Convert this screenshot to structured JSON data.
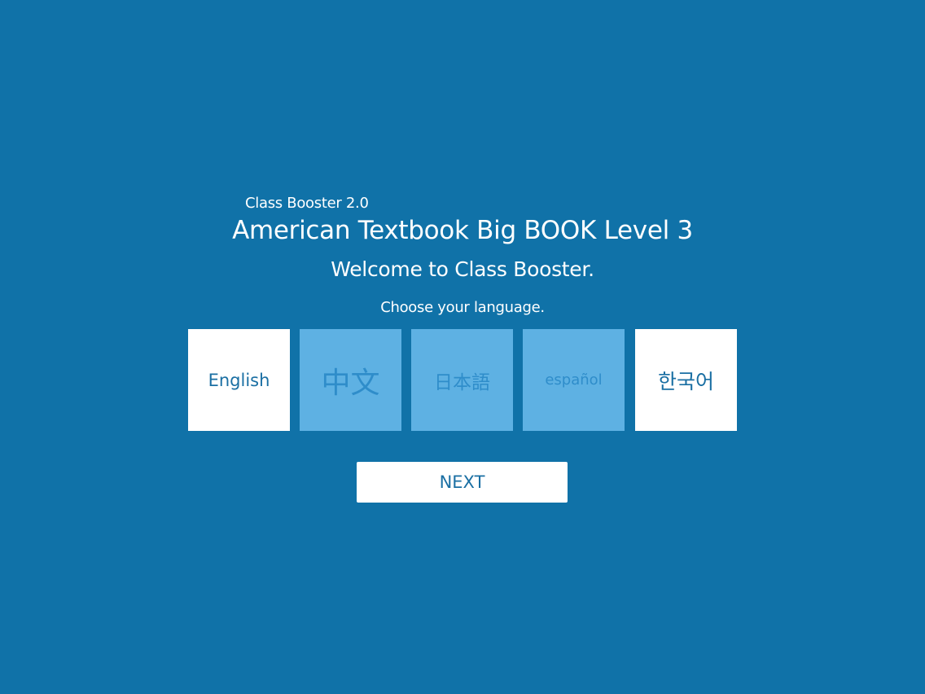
{
  "app": {
    "version_label": "Class Booster 2.0",
    "title": "American Textbook Big BOOK Level 3",
    "welcome": "Welcome to Class Booster.",
    "prompt": "Choose your language."
  },
  "languages": [
    {
      "label": "English",
      "selected": true
    },
    {
      "label": "中文",
      "selected": false
    },
    {
      "label": "日本語",
      "selected": false
    },
    {
      "label": "español",
      "selected": false
    },
    {
      "label": "한국어",
      "selected": true
    }
  ],
  "actions": {
    "next_label": "NEXT"
  },
  "colors": {
    "background": "#1072a8",
    "tile_selected": "#ffffff",
    "tile_unselected": "#5eb1e3",
    "accent_text": "#1a6fa3"
  }
}
